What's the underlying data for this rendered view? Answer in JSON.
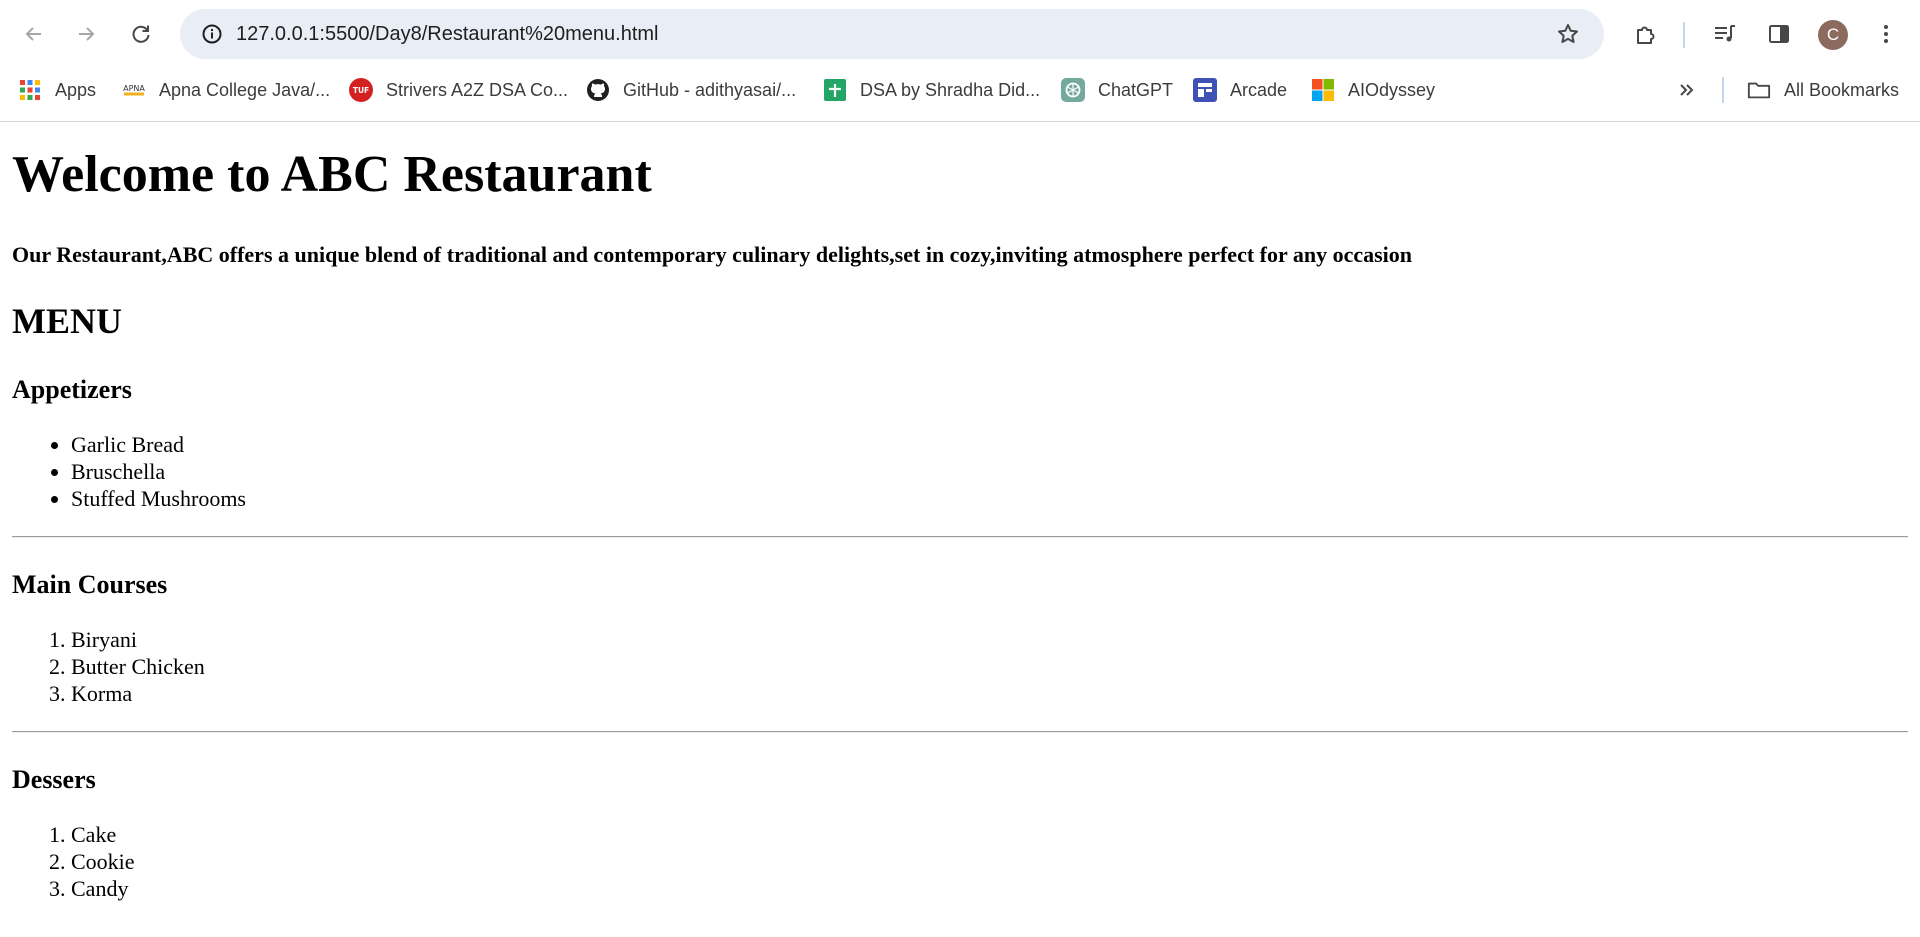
{
  "browser": {
    "url": "127.0.0.1:5500/Day8/Restaurant%20menu.html",
    "profile_initial": "C",
    "bookmarks": [
      {
        "label": "Apps",
        "icon": "apps-grid-icon"
      },
      {
        "label": "Apna College Java/...",
        "icon": "apna-college-icon"
      },
      {
        "label": "Strivers A2Z DSA Co...",
        "icon": "tuf-icon"
      },
      {
        "label": "GitHub - adithyasai/...",
        "icon": "github-icon"
      },
      {
        "label": "DSA by Shradha Did...",
        "icon": "google-sheets-icon"
      },
      {
        "label": "ChatGPT",
        "icon": "chatgpt-icon"
      },
      {
        "label": "Arcade",
        "icon": "arcade-icon"
      },
      {
        "label": "AIOdyssey",
        "icon": "microsoft-icon"
      }
    ],
    "all_bookmarks_label": "All Bookmarks"
  },
  "page": {
    "title": "Welcome to ABC Restaurant",
    "intro": "Our Restaurant,ABC offers a unique blend of traditional and contemporary culinary delights,set in cozy,inviting atmosphere perfect for any occasion",
    "menu_heading": "MENU",
    "sections": [
      {
        "heading": "Appetizers",
        "list_type": "bulleted",
        "items": [
          "Garlic Bread",
          "Bruschella",
          "Stuffed Mushrooms"
        ]
      },
      {
        "heading": "Main Courses",
        "list_type": "numbered",
        "items": [
          "Biryani",
          "Butter Chicken",
          "Korma"
        ]
      },
      {
        "heading": "Dessers",
        "list_type": "numbered",
        "items": [
          "Cake",
          "Cookie",
          "Candy"
        ]
      }
    ]
  }
}
